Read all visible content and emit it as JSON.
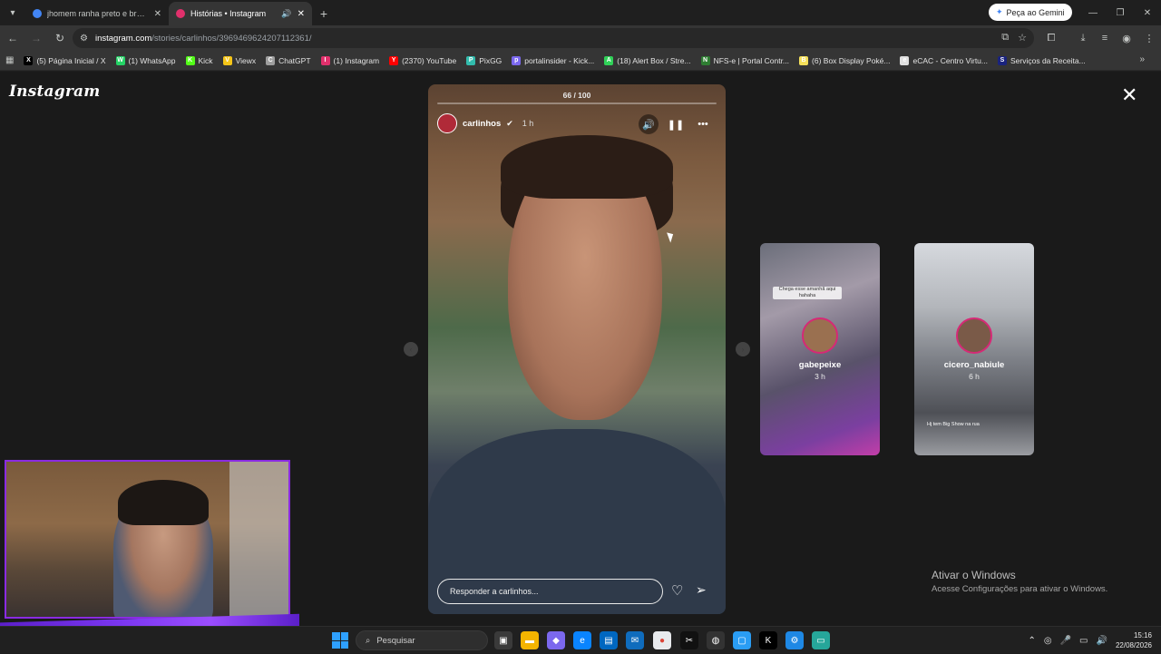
{
  "browser": {
    "tabs": [
      {
        "title": "jhomem ranha preto e branco",
        "favicon_color": "#4285f4",
        "active": false
      },
      {
        "title": "Histórias • Instagram",
        "favicon_color": "#e1306c",
        "active": true
      }
    ],
    "gemini_label": "Peça ao Gemini",
    "url_host": "instagram.com",
    "url_path": "/stories/carlinhos/3969469624207112361/",
    "bookmarks": [
      {
        "label": "(5) Página Inicial / X",
        "icon": "X",
        "color": "#000000"
      },
      {
        "label": "(1) WhatsApp",
        "icon": "W",
        "color": "#25d366"
      },
      {
        "label": "Kick",
        "icon": "K",
        "color": "#53fc18"
      },
      {
        "label": "Viewx",
        "icon": "V",
        "color": "#f5c518"
      },
      {
        "label": "ChatGPT",
        "icon": "C",
        "color": "#9e9e9e"
      },
      {
        "label": "(1) Instagram",
        "icon": "I",
        "color": "#e1306c"
      },
      {
        "label": "(2370) YouTube",
        "icon": "Y",
        "color": "#ff0000"
      },
      {
        "label": "PixGG",
        "icon": "P",
        "color": "#32bcad"
      },
      {
        "label": "portalinsider - Kick...",
        "icon": "p",
        "color": "#7b68ee"
      },
      {
        "label": "(18) Alert Box / Stre...",
        "icon": "A",
        "color": "#30d158"
      },
      {
        "label": "NFS-e | Portal Contr...",
        "icon": "N",
        "color": "#2e7d32"
      },
      {
        "label": "(6) Box Display Poké...",
        "icon": "B",
        "color": "#f5e05a"
      },
      {
        "label": "eCAC - Centro Virtu...",
        "icon": "e",
        "color": "#e0e0e0"
      },
      {
        "label": "Serviços da Receita...",
        "icon": "S",
        "color": "#1a237e"
      }
    ]
  },
  "instagram": {
    "logo": "Instagram",
    "story": {
      "count": "66 / 100",
      "progress": 0.0,
      "username": "carlinhos",
      "time": "1 h",
      "reply_placeholder": "Responder a carlinhos..."
    },
    "previews": [
      {
        "username": "gabepeixe",
        "time": "3 h",
        "tag": "Chega esse amanhã aqui hahaha"
      },
      {
        "username": "cicero_nabiule",
        "time": "6 h",
        "caption": "Hj tem Big Show na rua"
      }
    ]
  },
  "windows_activation": {
    "title": "Ativar o Windows",
    "subtitle": "Acesse Configurações para ativar o Windows."
  },
  "taskbar": {
    "search_placeholder": "Pesquisar",
    "time": "15:16",
    "date": "22/08/2026"
  }
}
